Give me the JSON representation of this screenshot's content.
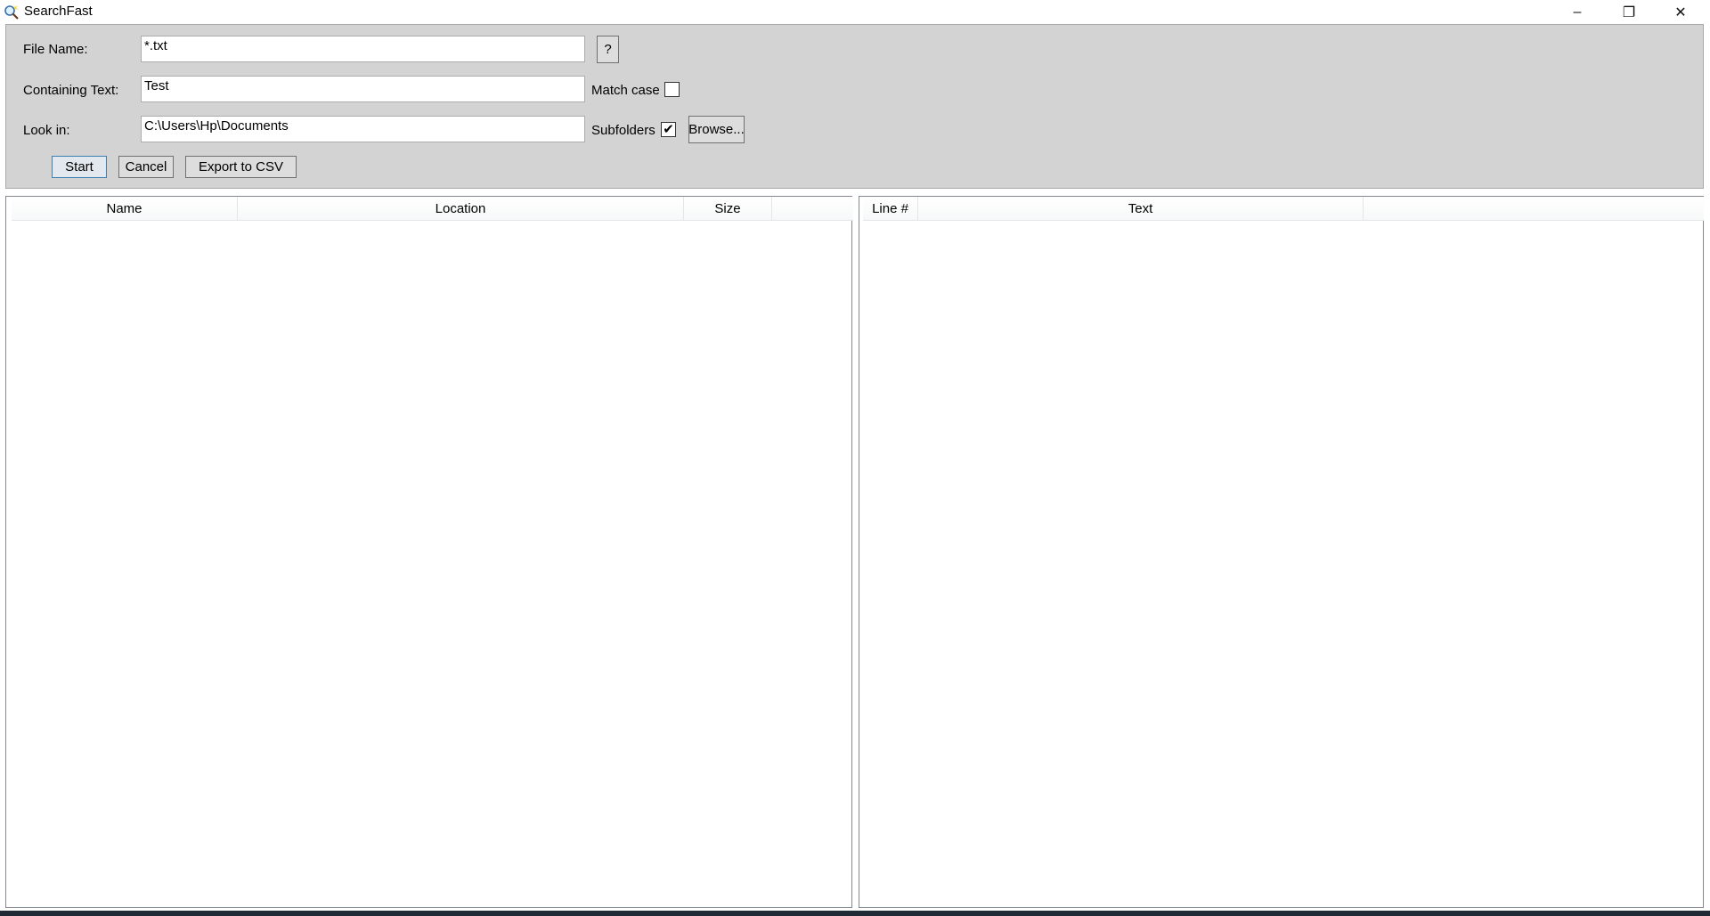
{
  "window": {
    "title": "SearchFast",
    "icon": "magnifier-icon",
    "controls": {
      "minimize": "–",
      "restore": "❐",
      "close": "✕"
    }
  },
  "form": {
    "file_name": {
      "label": "File Name:",
      "value": "*.txt",
      "help_label": "?"
    },
    "containing_text": {
      "label": "Containing Text:",
      "value": "Test",
      "match_case_label": "Match case",
      "match_case_checked": false,
      "match_case_mark": ""
    },
    "look_in": {
      "label": "Look in:",
      "value": "C:\\Users\\Hp\\Documents",
      "subfolders_label": "Subfolders",
      "subfolders_checked": true,
      "subfolders_mark": "✔",
      "browse_label": "Browse..."
    },
    "buttons": {
      "start": "Start",
      "cancel": "Cancel",
      "export": "Export to CSV"
    }
  },
  "files_list": {
    "columns": [
      "Name",
      "Location",
      "Size",
      ""
    ],
    "rows": []
  },
  "lines_list": {
    "columns": [
      "Line #",
      "Text",
      ""
    ],
    "rows": []
  }
}
